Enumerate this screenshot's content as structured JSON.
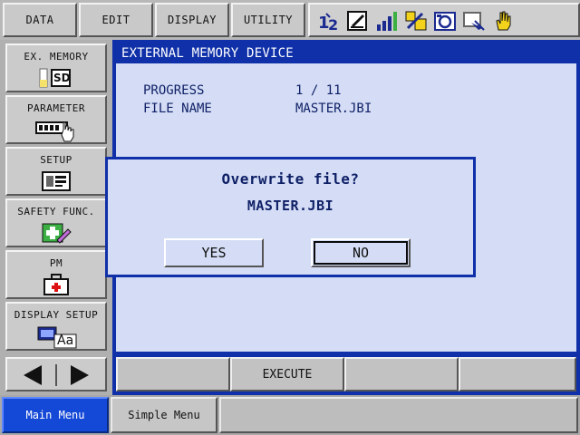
{
  "top_menu": [
    "DATA",
    "EDIT",
    "DISPLAY",
    "UTILITY"
  ],
  "status_icons": [
    "axis-group-icon",
    "edit-lock-icon",
    "signal-level-icon",
    "coordinate-icon",
    "camera-icon",
    "pendant-icon",
    "hand-icon"
  ],
  "sidebar": {
    "items": [
      {
        "label": "EX. MEMORY",
        "icon": "sd-card-icon"
      },
      {
        "label": "PARAMETER",
        "icon": "parameter-icon"
      },
      {
        "label": "SETUP",
        "icon": "setup-icon"
      },
      {
        "label": "SAFETY FUNC.",
        "icon": "safety-icon"
      },
      {
        "label": "PM",
        "icon": "pm-medkit-icon"
      },
      {
        "label": "DISPLAY SETUP",
        "icon": "display-font-icon"
      }
    ],
    "sd_text": "SD",
    "font_text": "Aa"
  },
  "main": {
    "title": "EXTERNAL MEMORY DEVICE",
    "progress_label": "PROGRESS",
    "progress_value": "1 / 11",
    "filename_label": "FILE NAME",
    "filename_value": "MASTER.JBI"
  },
  "dialog": {
    "question": "Overwrite file?",
    "filename": "MASTER.JBI",
    "yes": "YES",
    "no": "NO"
  },
  "function_bar": [
    "",
    "EXECUTE",
    "",
    ""
  ],
  "bottom": {
    "main_menu": "Main Menu",
    "simple_menu": "Simple Menu"
  }
}
